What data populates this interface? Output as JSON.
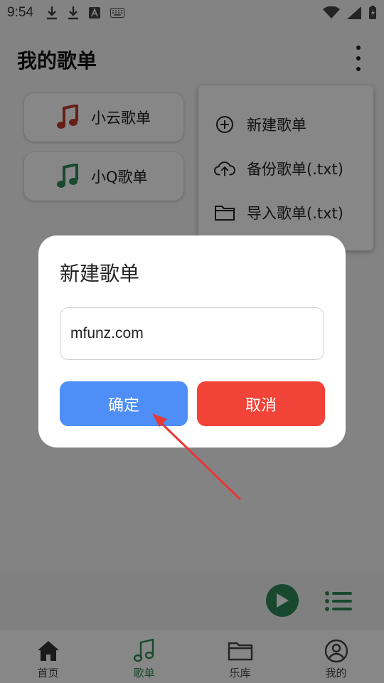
{
  "status_bar": {
    "time": "9:54"
  },
  "app_bar": {
    "title": "我的歌单"
  },
  "playlists": [
    {
      "label": "小云歌单",
      "color": "#c0392b"
    },
    {
      "label": "小Q歌单",
      "color": "#2e8b57"
    }
  ],
  "menu": {
    "items": [
      {
        "label": "新建歌单",
        "icon": "add-circle-icon"
      },
      {
        "label": "备份歌单(.txt)",
        "icon": "cloud-upload-icon"
      },
      {
        "label": "导入歌单(.txt)",
        "icon": "folder-icon"
      }
    ]
  },
  "dialog": {
    "title": "新建歌单",
    "input_value": "mfunz.com",
    "confirm_label": "确定",
    "cancel_label": "取消"
  },
  "bottom_nav": {
    "items": [
      {
        "label": "首页",
        "icon": "home-icon"
      },
      {
        "label": "歌单",
        "icon": "music-note-icon",
        "active": true
      },
      {
        "label": "乐库",
        "icon": "folder-icon"
      },
      {
        "label": "我的",
        "icon": "user-icon"
      }
    ]
  },
  "colors": {
    "accent_green": "#2e8b57",
    "confirm_blue": "#4f8ef7",
    "cancel_red": "#f14337",
    "arrow_red": "#e53935"
  }
}
